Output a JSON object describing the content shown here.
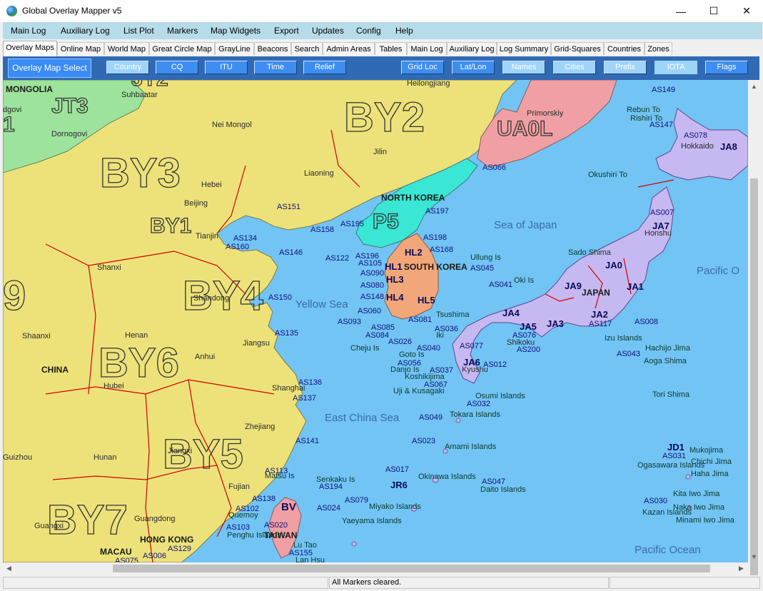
{
  "window": {
    "title": "Global Overlay Mapper v5",
    "min": "—",
    "max": "☐",
    "close": "✕"
  },
  "menu": [
    "Main Log",
    "Auxiliary Log",
    "List Plot",
    "Markers",
    "Map Widgets",
    "Export",
    "Updates",
    "Config",
    "Help"
  ],
  "tabs": [
    "Overlay Maps",
    "Online Map",
    "World Map",
    "Great Circle Map",
    "GrayLine",
    "Beacons",
    "Search",
    "Admin Areas",
    "Tables",
    "Main Log",
    "Auxiliary Log",
    "Log Summary",
    "Grid-Squares",
    "Countries",
    "Zones"
  ],
  "active_tab": "Overlay Maps",
  "toolbar": {
    "select_button": "Overlay Map Select",
    "buttons": [
      "Country",
      "CQ",
      "ITU",
      "Time",
      "Relief",
      "Grid Loc",
      "Lat/Lon",
      "Names",
      "Cities",
      "Prefix",
      "IOTA",
      "Flags"
    ]
  },
  "map": {
    "big_prefixes": [
      "BY2",
      "UA0L",
      "BY3",
      "BY1",
      "BY4",
      "BY6",
      "BY5",
      "BY7",
      "JT3",
      "JT2",
      "P5",
      "9",
      "1"
    ],
    "country_prefixes": [
      "HL2",
      "HL1",
      "HL3",
      "HL4",
      "HL5",
      "JA8",
      "JA7",
      "JA0",
      "JA9",
      "JA1",
      "JA2",
      "JA3",
      "JA4",
      "JA5",
      "JA6",
      "JD1",
      "JR6",
      "BV"
    ],
    "country_names": [
      "MONGOLIA",
      "NORTH KOREA",
      "SOUTH KOREA",
      "JAPAN",
      "CHINA",
      "TAIWAN",
      "HONG KONG",
      "MACAU"
    ],
    "regions": [
      "Suhbaatar",
      "Heilongjiang",
      "Primorskiy",
      "Dornogovi",
      "Nei Mongol",
      "Jilin",
      "Liaoning",
      "Hebei",
      "Beijing",
      "Tianjin",
      "Shanxi",
      "Shandong",
      "Henan",
      "Anhui",
      "Jiangsu",
      "Shanghai",
      "Hubei",
      "Zhejiang",
      "Jiangxi",
      "Hunan",
      "Fujian",
      "Guizhou",
      "Guangxi",
      "Guangdong",
      "Shaanxi",
      "Hokkaido",
      "Honshu",
      "Kyushu",
      "Shikoku",
      "dgovi"
    ],
    "seas": [
      "Sea of Japan",
      "Yellow Sea",
      "East China Sea",
      "Pacific O",
      "Pacific Ocean"
    ],
    "islands": [
      "Rebun To",
      "Rishiri To",
      "Okushiri To",
      "Sado Shima",
      "Ullung Is",
      "Oki Is",
      "Tsushima",
      "Iki",
      "Cheju Is",
      "Goto Is",
      "Danjo Is",
      "Koshikijima",
      "Uji & Kusagaki",
      "Osumi Islands",
      "Tokara Islands",
      "Amami Islands",
      "Okinawa Islands",
      "Senkaku Is",
      "Miyako Islands",
      "Yaeyama Islands",
      "Daito Islands",
      "Izu Islands",
      "Hachijo Jima",
      "Aoga Shima",
      "Tori Shima",
      "Mukojima",
      "Chichi Jima",
      "Haha Jima",
      "Ogasawara Islands",
      "Kita Iwo Jima",
      "Naka Iwo Jima",
      "Minami Iwo Jima",
      "Kazan Islands",
      "Matsu Is",
      "Quemoy",
      "Penghu Islands",
      "Lu Tao",
      "Lan Hsu"
    ],
    "iota": [
      "AS149",
      "AS147",
      "AS078",
      "AS066",
      "AS007",
      "AS197",
      "AS151",
      "AS158",
      "AS195",
      "AS198",
      "AS134",
      "AS160",
      "AS146",
      "AS122",
      "AS196",
      "AS168",
      "AS105",
      "AS045",
      "AS090",
      "AS080",
      "AS041",
      "AS148",
      "AS150",
      "AS060",
      "AS093",
      "AS085",
      "AS081",
      "AS084",
      "AS036",
      "AS076",
      "AS026",
      "AS040",
      "AS077",
      "AS200",
      "AS117",
      "AS008",
      "AS135",
      "AS056",
      "AS037",
      "AS012",
      "AS043",
      "AS136",
      "AS067",
      "AS137",
      "AS032",
      "AS049",
      "AS023",
      "AS141",
      "AS017",
      "AS113",
      "AS194",
      "AS047",
      "AS031",
      "AS138",
      "AS079",
      "AS024",
      "AS030",
      "AS102",
      "AS103",
      "AS020",
      "AS129",
      "AS155",
      "AS006",
      "AS075"
    ]
  },
  "status": {
    "left": "",
    "message": "All Markers cleared.",
    "right": ""
  }
}
